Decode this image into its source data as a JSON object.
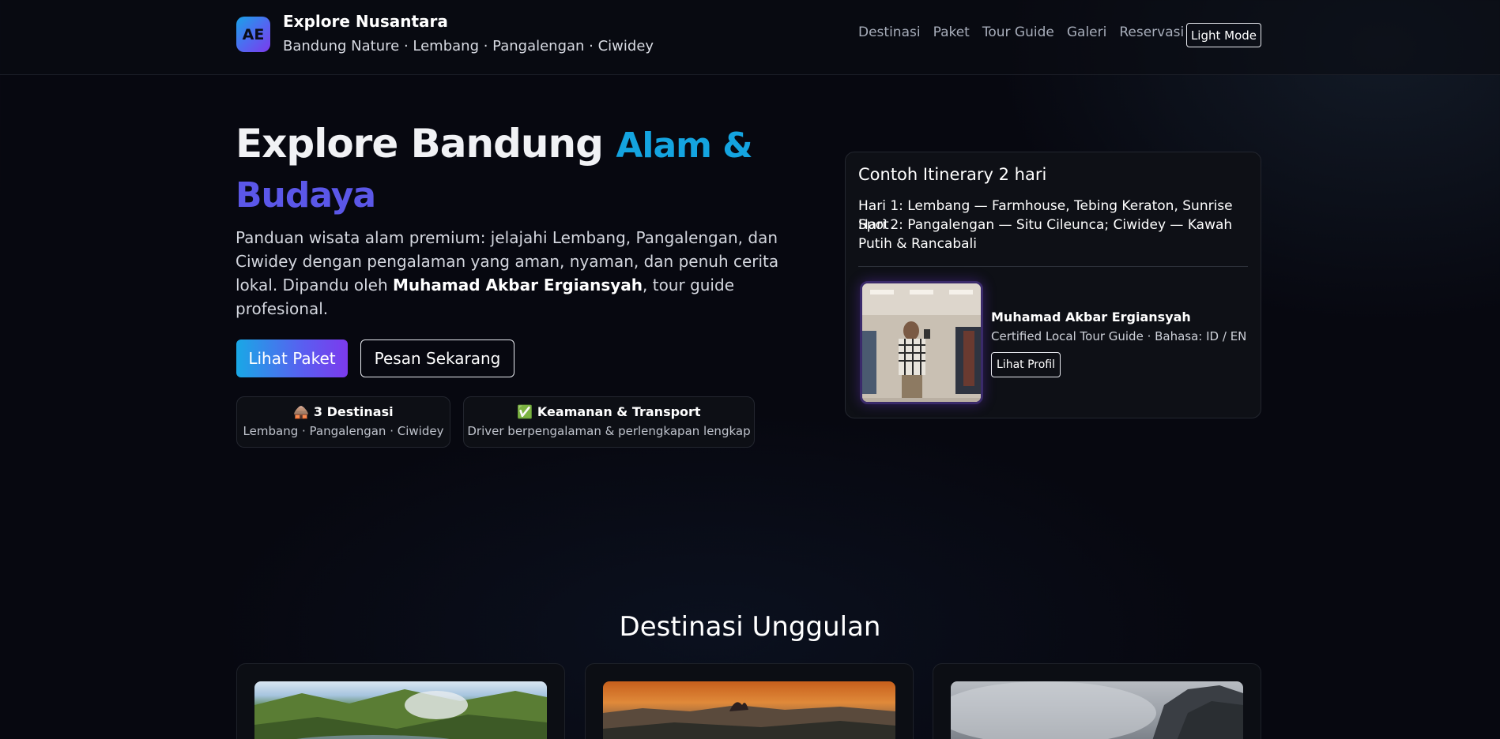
{
  "brand": {
    "logo_text": "AE",
    "title": "Explore Nusantara",
    "subtitle": "Bandung Nature · Lembang · Pangalengan · Ciwidey"
  },
  "nav": {
    "items": [
      "Destinasi",
      "Paket",
      "Tour Guide",
      "Galeri",
      "Reservasi"
    ],
    "mode_button": "Light Mode"
  },
  "hero": {
    "title_main": "Explore Bandung",
    "title_accent_1": "Alam &",
    "title_accent_2": "Budaya",
    "desc_before": "Panduan wisata alam premium: jelajahi Lembang, Pangalengan, dan Ciwidey dengan pengalaman yang aman, nyaman, dan penuh cerita lokal. Dipandu oleh ",
    "desc_name": "Muhamad Akbar Ergiansyah",
    "desc_after": ", tour guide profesional.",
    "primary_button": "Lihat Paket",
    "secondary_button": "Pesan Sekarang"
  },
  "stats": [
    {
      "icon": "🛖",
      "title": "3 Destinasi",
      "sub": "Lembang · Pangalengan · Ciwidey"
    },
    {
      "icon": "✅",
      "title": "Keamanan & Transport",
      "sub": "Driver berpengalaman & perlengkapan lengkap"
    }
  ],
  "itinerary": {
    "title": "Contoh Itinerary 2 hari",
    "day1": "Hari 1: Lembang — Farmhouse, Tebing Keraton, Sunrise Spot",
    "day2": "Hari 2: Pangalengan — Situ Cileunca; Ciwidey — Kawah Putih & Rancabali"
  },
  "guide": {
    "name": "Muhamad Akbar Ergiansyah",
    "role": "Certified Local Tour Guide · Bahasa: ID / EN",
    "button": "Lihat Profil"
  },
  "destinations_section": {
    "title": "Destinasi Unggulan"
  },
  "colors": {
    "accent_blue": "#14a4e0",
    "accent_purple": "#7c3aed",
    "background": "#070810"
  }
}
